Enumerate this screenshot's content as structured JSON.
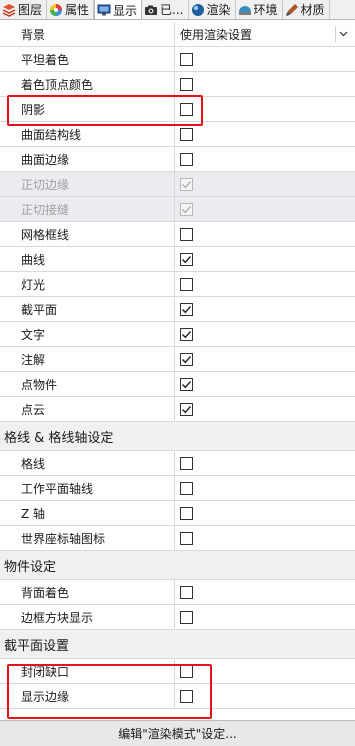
{
  "tabs": [
    {
      "label": "图层",
      "icon": "layers-icon",
      "color": "#d0452f"
    },
    {
      "label": "属性",
      "icon": "color-wheel-icon",
      "color": "#3a8fd8"
    },
    {
      "label": "显示",
      "icon": "monitor-icon",
      "color": "#2a5ea8"
    },
    {
      "label": "已...",
      "icon": "camera-icon",
      "color": "#333333"
    },
    {
      "label": "渲染",
      "icon": "render-sphere-icon",
      "color": "#1f5fa0"
    },
    {
      "label": "环境",
      "icon": "environment-icon",
      "color": "#2f8fc0"
    },
    {
      "label": "材质",
      "icon": "material-brush-icon",
      "color": "#b0552a"
    }
  ],
  "header": {
    "label": "背景",
    "value": "使用渲染设置"
  },
  "display_rows": [
    {
      "label": "平坦着色",
      "checked": false,
      "disabled": false
    },
    {
      "label": "着色顶点颜色",
      "checked": false,
      "disabled": false
    },
    {
      "label": "阴影",
      "checked": false,
      "disabled": false
    },
    {
      "label": "曲面结构线",
      "checked": false,
      "disabled": false
    },
    {
      "label": "曲面边缘",
      "checked": false,
      "disabled": false
    },
    {
      "label": "正切边缘",
      "checked": true,
      "disabled": true
    },
    {
      "label": "正切接缝",
      "checked": true,
      "disabled": true
    },
    {
      "label": "网格框线",
      "checked": false,
      "disabled": false
    },
    {
      "label": "曲线",
      "checked": true,
      "disabled": false
    },
    {
      "label": "灯光",
      "checked": false,
      "disabled": false
    },
    {
      "label": "截平面",
      "checked": true,
      "disabled": false
    },
    {
      "label": "文字",
      "checked": true,
      "disabled": false
    },
    {
      "label": "注解",
      "checked": true,
      "disabled": false
    },
    {
      "label": "点物件",
      "checked": true,
      "disabled": false
    },
    {
      "label": "点云",
      "checked": true,
      "disabled": false
    }
  ],
  "grid_section": {
    "title": "格线 & 格线轴设定",
    "rows": [
      {
        "label": "格线",
        "checked": false
      },
      {
        "label": "工作平面轴线",
        "checked": false
      },
      {
        "label": "Z 轴",
        "checked": false
      },
      {
        "label": "世界座标轴图标",
        "checked": false
      }
    ]
  },
  "object_section": {
    "title": "物件设定",
    "rows": [
      {
        "label": "背面着色",
        "checked": false
      },
      {
        "label": "边框方块显示",
        "checked": false
      }
    ]
  },
  "clip_section": {
    "title": "截平面设置",
    "rows": [
      {
        "label": "封闭缺口",
        "checked": false
      },
      {
        "label": "显示边缘",
        "checked": false
      }
    ]
  },
  "footer": {
    "label": "编辑\"渲染模式\"设定..."
  },
  "highlight_color": "#e8101b"
}
